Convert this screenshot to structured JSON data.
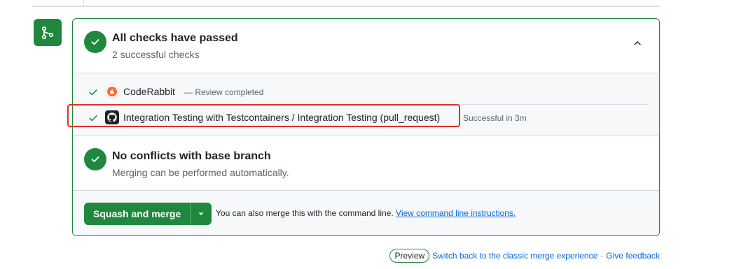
{
  "checks_header": {
    "title": "All checks have passed",
    "subtitle": "2 successful checks"
  },
  "checks": [
    {
      "name": "CodeRabbit",
      "description": "— Review completed",
      "icon": "coderabbit-icon",
      "status": "success"
    },
    {
      "name": "Integration Testing with Testcontainers / Integration Testing (pull_request)",
      "description": "Successful in 3m",
      "icon": "github-icon",
      "status": "success"
    }
  ],
  "conflicts": {
    "title": "No conflicts with base branch",
    "subtitle": "Merging can be performed automatically."
  },
  "merge": {
    "button_label": "Squash and merge",
    "hint_text": "You can also merge this with the command line. ",
    "hint_link": "View command line instructions."
  },
  "footer": {
    "badge": "Preview",
    "switch_link": "Switch back to the classic merge experience",
    "separator": "·",
    "feedback_link": "Give feedback"
  },
  "colors": {
    "success": "#1f883d",
    "link": "#0969da",
    "highlight": "#e0302a"
  }
}
